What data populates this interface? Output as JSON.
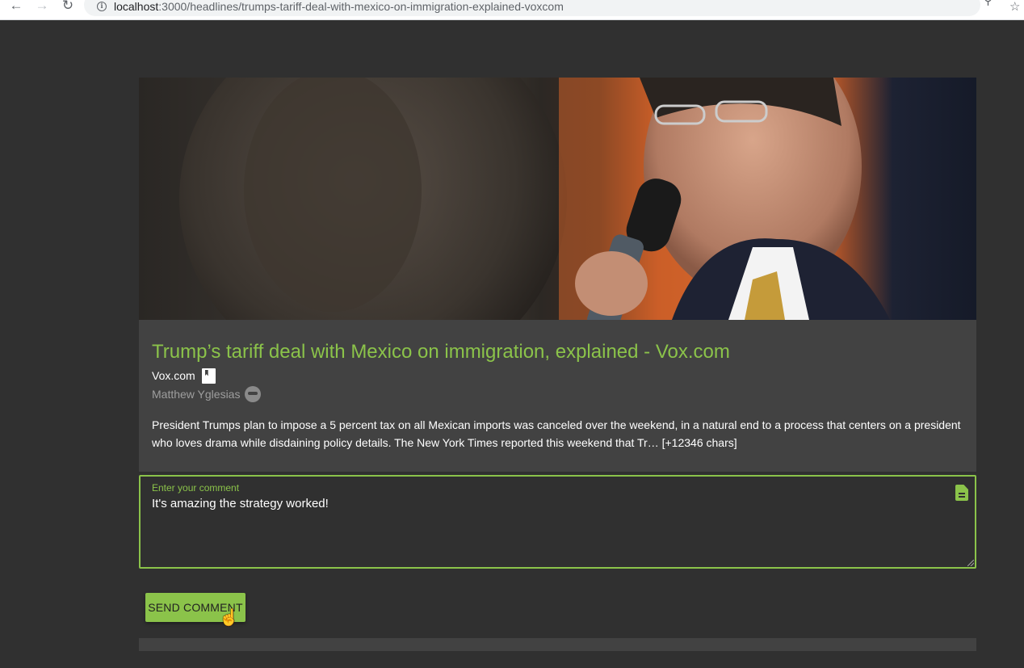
{
  "browser": {
    "url_host": "localhost",
    "url_path": ":3000/headlines/trumps-tariff-deal-with-mexico-on-immigration-explained-voxcom",
    "back_icon": "arrow-left-icon",
    "forward_icon": "arrow-right-icon",
    "reload_icon": "reload-icon",
    "key_icon": "key-icon",
    "star_icon": "star-icon"
  },
  "article": {
    "image_icon": "article-photo",
    "title": "Trump’s tariff deal with Mexico on immigration, explained - Vox.com",
    "source": "Vox.com",
    "author": "Matthew Yglesias",
    "description": "President Trumps plan to impose a 5 percent tax on all Mexican imports was canceled over the weekend, in a natural end to a process that centers on a president who loves drama while disdaining policy details. The New York Times reported this weekend that Tr… [+12346 chars]"
  },
  "comment": {
    "label": "Enter your comment",
    "value": "It's amazing the strategy worked!",
    "send_label": "Send Comment"
  },
  "colors": {
    "accent": "#8bc34a",
    "background": "#303030",
    "card": "#424242"
  }
}
